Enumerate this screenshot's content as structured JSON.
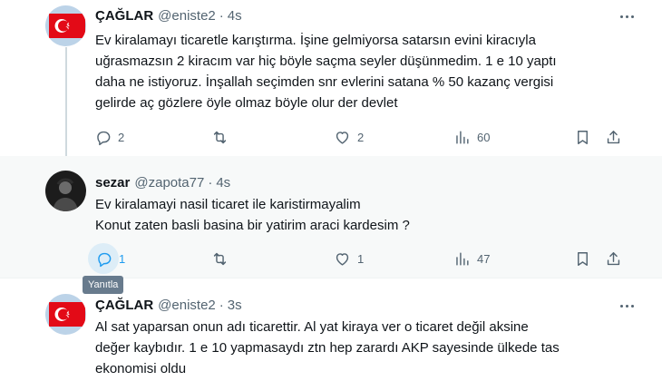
{
  "tweets": [
    {
      "name": "ÇAĞLAR",
      "handle": "@eniste2",
      "dot": "·",
      "time": "4s",
      "lines": [
        "Ev kiralamayı ticaretle karıştırma. İşine gelmiyorsa satarsın evini kiracıyla",
        "uğrasmazsın 2 kiracım var hiç böyle saçma seyler düşünmedim. 1 e 10 yaptı",
        "daha ne istiyoruz. İnşallah seçimden snr evlerini satana % 50 kazanç vergisi",
        "gelirde aç gözlere öyle olmaz böyle olur der devlet"
      ],
      "replies": "2",
      "retweets": "",
      "likes": "2",
      "views": "60"
    },
    {
      "name": "sezar",
      "handle": "@zapota77",
      "dot": "·",
      "time": "4s",
      "lines": [
        "Ev kiralamayi nasil ticaret ile karistirmayalim",
        "Konut zaten basli basina bir yatirim araci kardesim ?"
      ],
      "replies": "1",
      "retweets": "",
      "likes": "1",
      "views": "47"
    },
    {
      "name": "ÇAĞLAR",
      "handle": "@eniste2",
      "dot": "·",
      "time": "3s",
      "lines": [
        "Al sat yaparsan onun adı ticarettir. Al yat kiraya ver o ticaret değil aksine",
        "değer kaybıdır. 1 e 10 yapmasaydı ztn hep zarardı AKP sayesinde ülkede tas",
        "ekonomisi oldu"
      ]
    }
  ],
  "tooltip": "Yanıtla",
  "icons": {
    "reply": "reply-icon",
    "retweet": "retweet-icon",
    "like": "heart-icon",
    "views": "views-icon",
    "bookmark": "bookmark-icon",
    "share": "share-icon",
    "more": "more-icon"
  },
  "colors": {
    "accent": "#1d9bf0",
    "secondary_text": "#536471",
    "flag_red": "#e30a17"
  }
}
